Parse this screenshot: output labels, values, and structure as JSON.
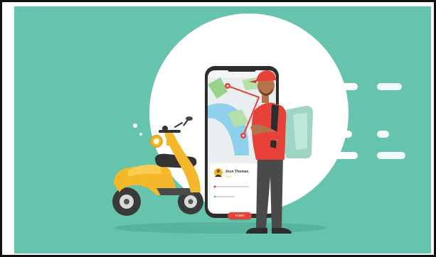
{
  "colors": {
    "background": "#66c3ac",
    "circle": "#ffffff",
    "scooter_body": "#f4b82a",
    "shirt": "#e8413a",
    "map_route": "#e8413a"
  },
  "phone_card": {
    "courier_name": "Arun Thomas",
    "status": "••••••",
    "action_button": "START"
  },
  "icons": [
    "scooter-icon",
    "phone-icon",
    "courier-icon",
    "map-pin-icon",
    "speed-lines-icon",
    "call-icon"
  ]
}
